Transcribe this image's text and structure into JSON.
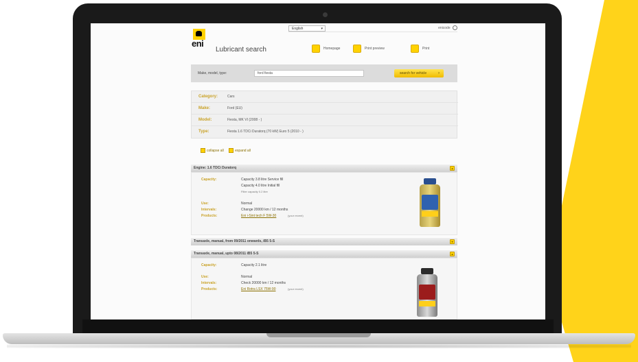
{
  "background": {
    "accent": "#ffd31a"
  },
  "topbar": {
    "language": "English",
    "right_text": "enicode"
  },
  "header": {
    "brand": "eni",
    "title": "Lubricant search"
  },
  "nav": {
    "items": [
      {
        "label": "Homepage",
        "icon": "home-icon"
      },
      {
        "label": "Print preview",
        "icon": "print-preview-icon"
      },
      {
        "label": "Print",
        "icon": "print-icon"
      }
    ]
  },
  "search": {
    "label": "Make, model, type:",
    "value": "ford fiesta",
    "button_label": "search for vehicle"
  },
  "criteria": [
    {
      "label": "Category:",
      "value": "Cars"
    },
    {
      "label": "Make:",
      "value": "Ford (EU)"
    },
    {
      "label": "Model:",
      "value": "Fiesta, MK VI (2008 - )"
    },
    {
      "label": "Type:",
      "value": "Fiesta 1.6 TDCi Duratorq (70 kW) Euro 5 (2010 - )"
    }
  ],
  "expand": {
    "collapse_all": "collapse all",
    "expand_all": "expand all"
  },
  "sections": [
    {
      "title": "Engine: 1.6 TDCi Duratorq",
      "rows": [
        {
          "label": "Capacity:",
          "lines": [
            "Capacity 3.8 litre Service fill",
            "Capacity 4.0 litre Initial fill",
            "Filter capacity 0.2 litre"
          ]
        },
        {
          "label": "Use:",
          "lines": [
            "Normal"
          ]
        },
        {
          "label": "Intervals:",
          "lines": [
            "Change 20000 km / 12 months"
          ]
        },
        {
          "label": "Products:",
          "lines": [
            "Eni i-Sint tech F 5W-30"
          ],
          "suffix": "(your recent)"
        }
      ]
    },
    {
      "title": "Transaxle, manual, from 09/2011 onwards, iB5 5-S",
      "rows": []
    },
    {
      "title": "Transaxle, manual, upto 08/2011 iB5 5-S",
      "rows": [
        {
          "label": "Capacity:",
          "lines": [
            "Capacity 2.1 litre"
          ]
        },
        {
          "label": "Use:",
          "lines": [
            "Normal"
          ]
        },
        {
          "label": "Intervals:",
          "lines": [
            "Check 20000 km / 12 months"
          ]
        },
        {
          "label": "Products:",
          "lines": [
            "Eni Rotra LSX 75W-90"
          ],
          "suffix": "(your recent)"
        }
      ]
    }
  ]
}
